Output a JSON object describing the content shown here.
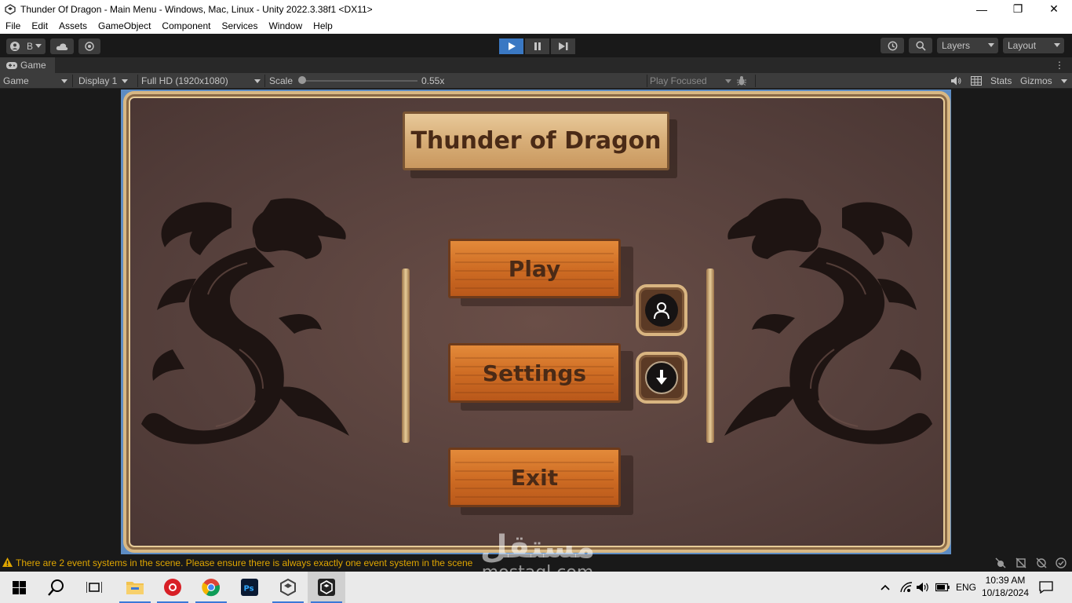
{
  "window": {
    "title": "Thunder Of Dragon - Main Menu - Windows, Mac, Linux - Unity 2022.3.38f1 <DX11>",
    "controls": {
      "minimize": "—",
      "maximize": "❐",
      "close": "✕"
    }
  },
  "menubar": [
    "File",
    "Edit",
    "Assets",
    "GameObject",
    "Component",
    "Services",
    "Window",
    "Help"
  ],
  "toolbar": {
    "account_label": "B",
    "layers_label": "Layers",
    "layout_label": "Layout"
  },
  "game_tab": {
    "label": "Game",
    "menu_dots": "⋮"
  },
  "game_toolbar": {
    "mode": "Game",
    "display": "Display 1",
    "resolution": "Full HD (1920x1080)",
    "scale_label": "Scale",
    "scale_value": "0.55x",
    "play_focused": "Play Focused",
    "stats": "Stats",
    "gizmos": "Gizmos"
  },
  "game": {
    "title": "Thunder of Dragon",
    "buttons": {
      "play": "Play",
      "settings": "Settings",
      "exit": "Exit"
    }
  },
  "status": {
    "message": "There are 2 event systems in the scene. Please ensure there is always exactly one event system in the scene"
  },
  "watermark": {
    "arabic": "مستقل",
    "latin": "mostaql.com"
  },
  "taskbar": {
    "language": "ENG",
    "time": "10:39 AM",
    "date": "10/18/2024"
  },
  "colors": {
    "unity_blue": "#3a78c3",
    "board_frame": "#d8b884",
    "plank_orange": "#cf6d24",
    "title_text": "#4a2a16"
  }
}
